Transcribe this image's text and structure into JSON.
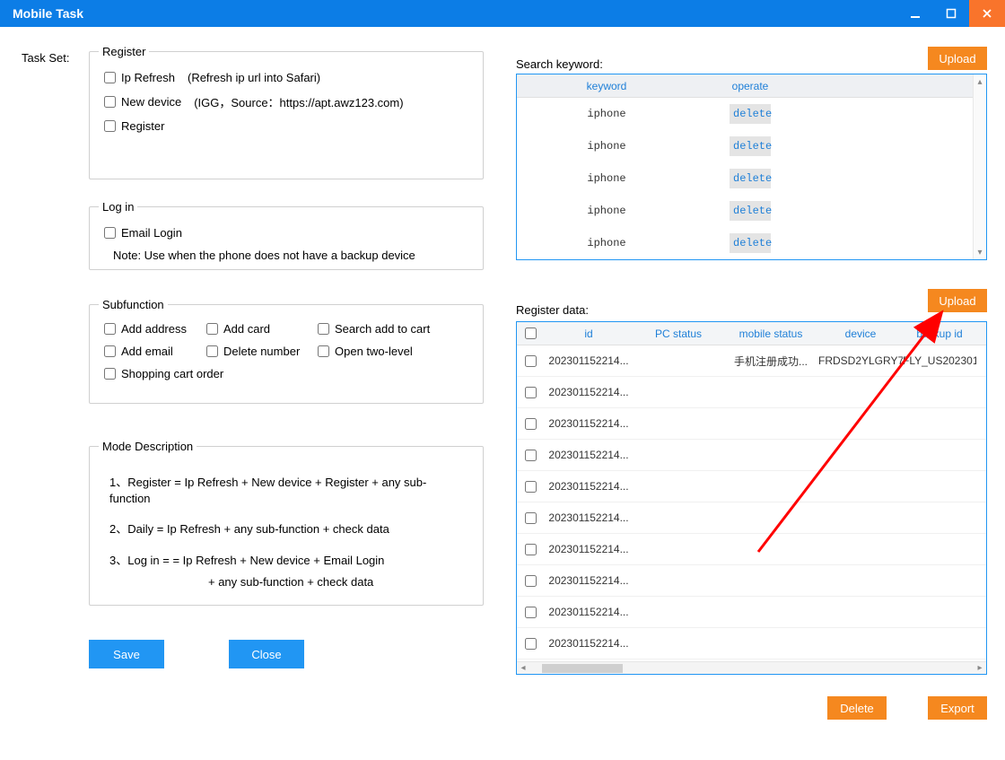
{
  "window": {
    "title": "Mobile Task"
  },
  "left": {
    "task_set_label": "Task Set:",
    "register": {
      "legend": "Register",
      "ip_refresh": "Ip Refresh",
      "ip_refresh_hint": "(Refresh ip url into Safari)",
      "new_device": "New device",
      "new_device_hint": "(IGG，Source：https://apt.awz123.com)",
      "register": "Register"
    },
    "login": {
      "legend": "Log in",
      "email_login": "Email Login",
      "note": "Note: Use when the phone does not have a backup device"
    },
    "subfn": {
      "legend": "Subfunction",
      "items": {
        "add_address": "Add address",
        "add_card": "Add card",
        "search_add_to_cart": "Search add to cart",
        "add_email": "Add email",
        "delete_number": "Delete number",
        "open_two_level": "Open two-level",
        "shopping_cart_order": "Shopping cart order"
      }
    },
    "mode": {
      "legend": "Mode Description",
      "line1": "1、Register = Ip Refresh + New device + Register + any sub-function",
      "line2": "2、Daily =   Ip Refresh + any sub-function + check data",
      "line3a": "3、Log in =  = Ip Refresh + New device + Email Login",
      "line3b": "+ any sub-function + check data"
    },
    "save": "Save",
    "close": "Close"
  },
  "right": {
    "sk": {
      "label": "Search keyword:",
      "upload": "Upload",
      "headers": {
        "keyword": "keyword",
        "operate": "operate"
      },
      "delete": "delete",
      "rows": [
        {
          "keyword": "iphone"
        },
        {
          "keyword": "iphone"
        },
        {
          "keyword": "iphone"
        },
        {
          "keyword": "iphone"
        },
        {
          "keyword": "iphone"
        }
      ]
    },
    "rd": {
      "label": "Register data:",
      "upload": "Upload",
      "headers": {
        "id": "id",
        "pc": "PC status",
        "ms": "mobile status",
        "device": "device",
        "backup": "backup id"
      },
      "rows": [
        {
          "id": "202301152214...",
          "pc": "",
          "ms": "手机注册成功...",
          "device": "FRDSD2YLGRY7",
          "backup": "FLY_US202301..."
        },
        {
          "id": "202301152214...",
          "pc": "",
          "ms": "",
          "device": "",
          "backup": ""
        },
        {
          "id": "202301152214...",
          "pc": "",
          "ms": "",
          "device": "",
          "backup": ""
        },
        {
          "id": "202301152214...",
          "pc": "",
          "ms": "",
          "device": "",
          "backup": ""
        },
        {
          "id": "202301152214...",
          "pc": "",
          "ms": "",
          "device": "",
          "backup": ""
        },
        {
          "id": "202301152214...",
          "pc": "",
          "ms": "",
          "device": "",
          "backup": ""
        },
        {
          "id": "202301152214...",
          "pc": "",
          "ms": "",
          "device": "",
          "backup": ""
        },
        {
          "id": "202301152214...",
          "pc": "",
          "ms": "",
          "device": "",
          "backup": ""
        },
        {
          "id": "202301152214...",
          "pc": "",
          "ms": "",
          "device": "",
          "backup": ""
        },
        {
          "id": "202301152214...",
          "pc": "",
          "ms": "",
          "device": "",
          "backup": ""
        }
      ],
      "delete": "Delete",
      "export": "Export"
    }
  }
}
